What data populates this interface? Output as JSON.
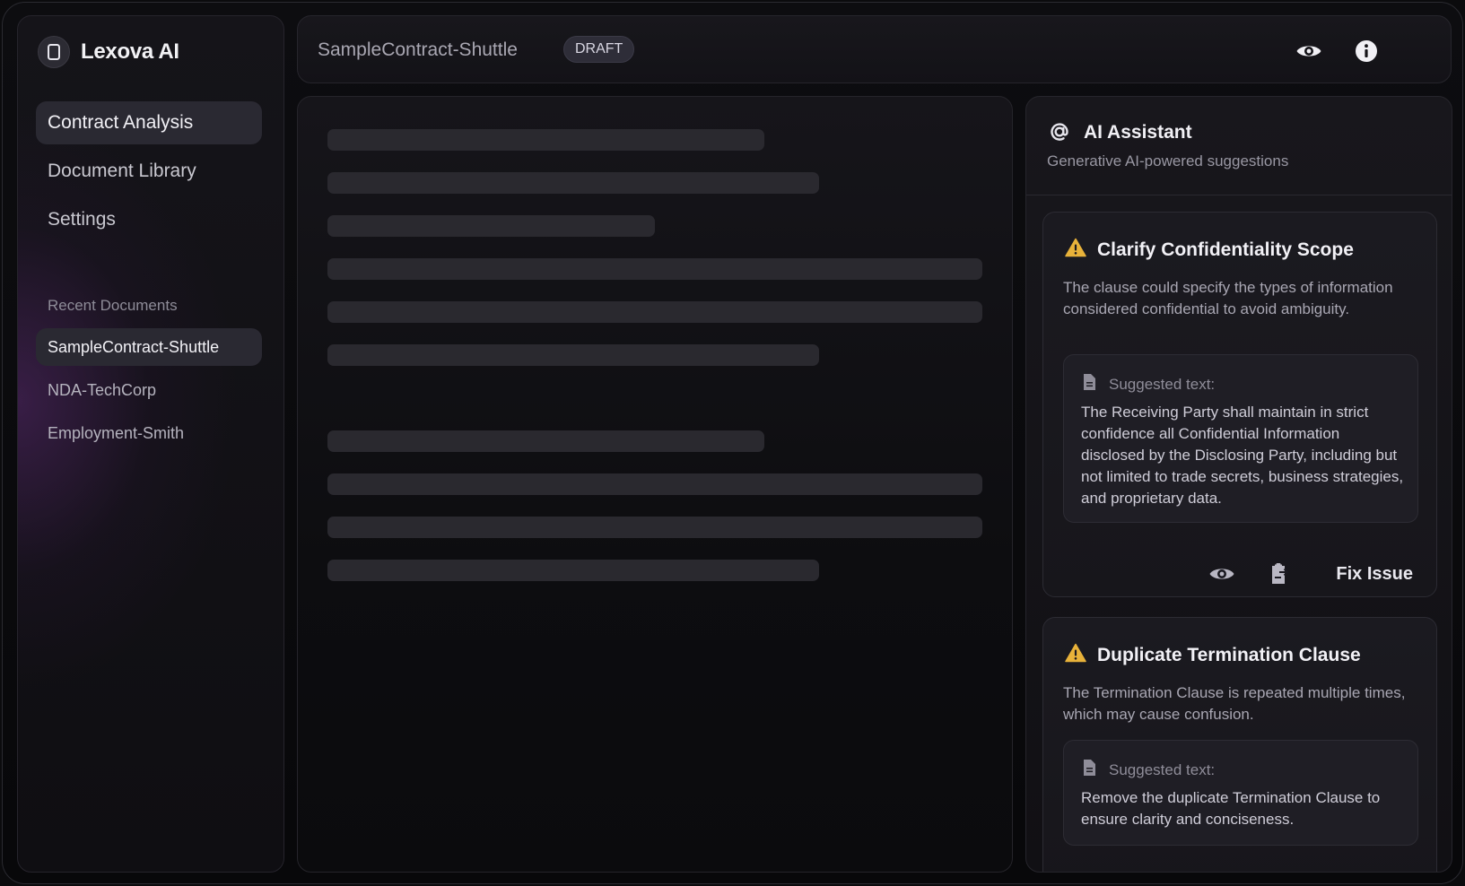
{
  "app": {
    "name": "Lexova AI"
  },
  "nav": {
    "items": [
      {
        "label": "Contract Analysis",
        "active": true
      },
      {
        "label": "Document Library",
        "active": false
      },
      {
        "label": "Settings",
        "active": false
      }
    ]
  },
  "recent": {
    "title": "Recent Documents",
    "items": [
      {
        "label": "SampleContract-Shuttle",
        "active": true
      },
      {
        "label": "NDA-TechCorp",
        "active": false
      },
      {
        "label": "Employment-Smith",
        "active": false
      }
    ]
  },
  "header": {
    "doc_title": "SampleContract-Shuttle",
    "status_badge": "DRAFT",
    "icons": [
      "eye-icon",
      "info-icon"
    ]
  },
  "assistant": {
    "title": "AI Assistant",
    "subtitle": "Generative AI-powered suggestions",
    "cards": [
      {
        "title": "Clarify Confidentiality Scope",
        "description": "The clause could specify the types of information considered confidential to avoid ambiguity.",
        "suggested_label": "Suggested text:",
        "suggested_text": "The Receiving Party shall maintain in strict confidence all Confidential Information disclosed by the Disclosing Party, including but not limited to trade secrets, business strategies, and proprietary data.",
        "fix_label": "Fix Issue"
      },
      {
        "title": "Duplicate Termination Clause",
        "description": "The Termination Clause is repeated multiple times, which may cause confusion.",
        "suggested_label": "Suggested text:",
        "suggested_text": "Remove the duplicate Termination Clause to ensure clarity and conciseness."
      }
    ]
  },
  "colors": {
    "accent_warning": "#e8b23a",
    "background": "#0b0b0d",
    "panel": "#18171c",
    "active_item": "#2a2932"
  }
}
